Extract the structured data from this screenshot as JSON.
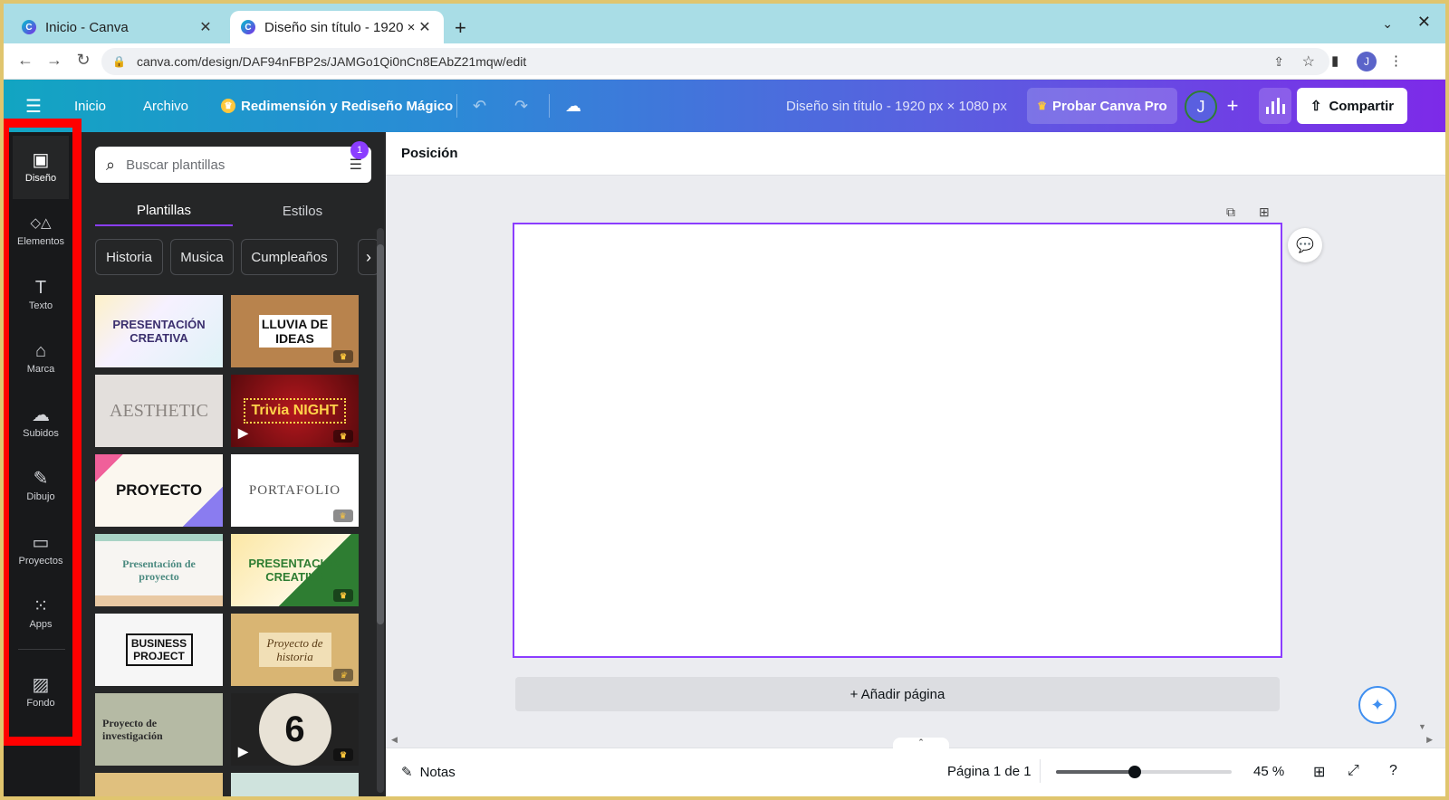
{
  "browser": {
    "tabs": [
      {
        "title": "Inicio - Canva",
        "active": false
      },
      {
        "title": "Diseño sin título - 1920 ×",
        "active": true
      }
    ],
    "url": "canva.com/design/DAF94nFBP2s/JAMGo1Qi0nCn8EAbZ21mqw/edit",
    "profile_initial": "J"
  },
  "header": {
    "home": "Inicio",
    "file": "Archivo",
    "magic_resize": "Redimensión y Rediseño Mágico",
    "design_title": "Diseño sin título - 1920 px × 1080 px",
    "pro_button": "Probar Canva Pro",
    "user_initial": "J",
    "share_button": "Compartir",
    "brand_gradient": [
      "#12a5c2",
      "#7d2ae8"
    ]
  },
  "rail": {
    "items": [
      {
        "label": "Diseño",
        "icon": "layout-icon",
        "glyph": "▣",
        "active": true
      },
      {
        "label": "Elementos",
        "icon": "shapes-icon",
        "glyph": "◇△",
        "active": false
      },
      {
        "label": "Texto",
        "icon": "text-icon",
        "glyph": "T",
        "active": false
      },
      {
        "label": "Marca",
        "icon": "brand-icon",
        "glyph": "⌂",
        "active": false
      },
      {
        "label": "Subidos",
        "icon": "upload-cloud-icon",
        "glyph": "☁",
        "active": false
      },
      {
        "label": "Dibujo",
        "icon": "draw-icon",
        "glyph": "✎",
        "active": false
      },
      {
        "label": "Proyectos",
        "icon": "folder-icon",
        "glyph": "▭",
        "active": false
      },
      {
        "label": "Apps",
        "icon": "apps-grid-icon",
        "glyph": "⁙",
        "active": false
      },
      {
        "label": "Fondo",
        "icon": "background-icon",
        "glyph": "▨",
        "active": false
      }
    ],
    "highlight_color": "#ff0000"
  },
  "panel": {
    "search_placeholder": "Buscar plantillas",
    "filter_badge": "1",
    "tabs": [
      "Plantillas",
      "Estilos"
    ],
    "chips": [
      "Historia",
      "Musica",
      "Cumpleaños"
    ],
    "templates": [
      {
        "text": "PRESENTACIÓN CREATIVA",
        "premium": false,
        "video": false
      },
      {
        "text": "LLUVIA DE IDEAS",
        "premium": true,
        "video": false
      },
      {
        "text": "AESTHETIC",
        "premium": false,
        "video": false
      },
      {
        "text": "Trivia NIGHT",
        "premium": true,
        "video": true
      },
      {
        "text": "PROYECTO",
        "premium": false,
        "video": false
      },
      {
        "text": "PORTAFOLIO",
        "premium": true,
        "video": false
      },
      {
        "text": "Presentación de proyecto",
        "premium": false,
        "video": false
      },
      {
        "text": "PRESENTACIÓN CREATIVA",
        "premium": true,
        "video": false
      },
      {
        "text": "BUSINESS PROJECT",
        "premium": false,
        "video": false
      },
      {
        "text": "Proyecto de historia",
        "premium": true,
        "video": false
      },
      {
        "text": "Proyecto de investigación",
        "premium": false,
        "video": false
      },
      {
        "text": "6",
        "premium": true,
        "video": true
      }
    ]
  },
  "editor": {
    "context_label": "Posición",
    "add_page": "+ Añadir página"
  },
  "footer": {
    "notes": "Notas",
    "page_indicator": "Página 1 de 1",
    "zoom": "45 %",
    "zoom_value": 45
  }
}
